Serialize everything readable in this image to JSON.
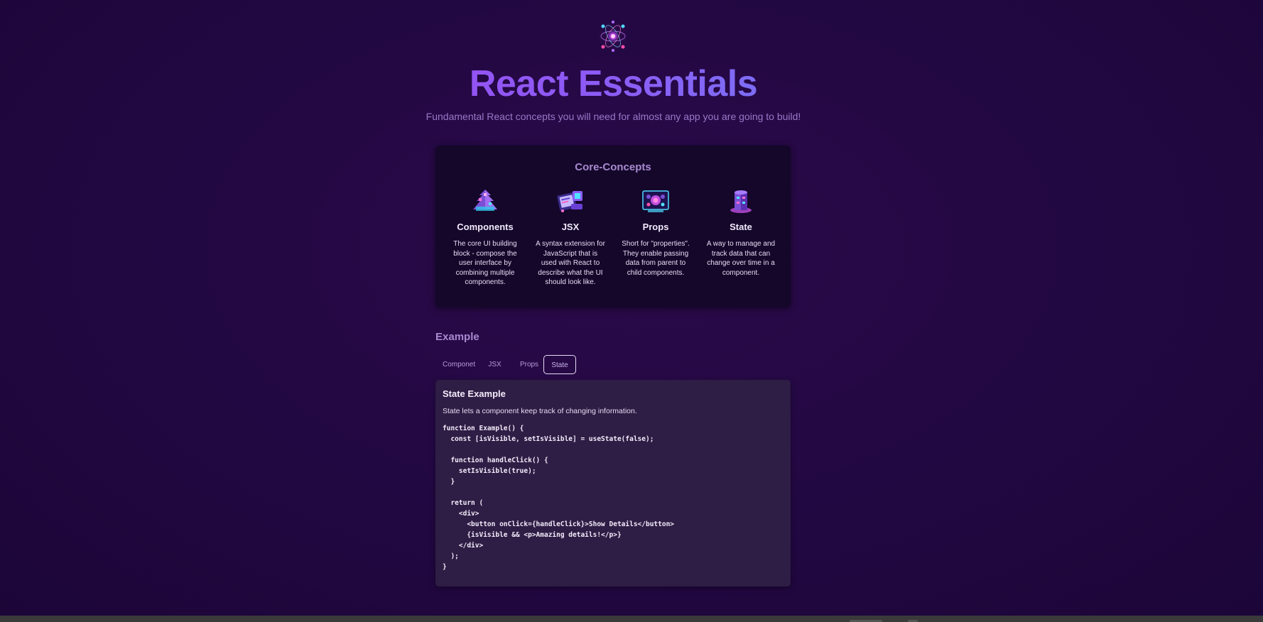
{
  "header": {
    "logo_icon": "atom-icon",
    "title": "React Essentials",
    "subtitle": "Fundamental React concepts you will need for almost any app you are going to build!"
  },
  "core_concepts": {
    "title": "Core-Concepts",
    "items": [
      {
        "icon": "components-icon",
        "name": "Components",
        "description": "The core UI building block - compose the user interface by combining multiple components."
      },
      {
        "icon": "jsx-icon",
        "name": "JSX",
        "description": "A syntax extension for JavaScript that is used with React to describe what the UI should look like."
      },
      {
        "icon": "props-icon",
        "name": "Props",
        "description": "Short for \"properties\". They enable passing data from parent to child components."
      },
      {
        "icon": "state-icon",
        "name": "State",
        "description": "A way to manage and track data that can change over time in a component."
      }
    ]
  },
  "example": {
    "heading": "Example",
    "tabs": [
      {
        "label": "Componet",
        "active": false
      },
      {
        "label": "JSX",
        "active": false
      },
      {
        "label": "Props",
        "active": false
      },
      {
        "label": "State",
        "active": true
      }
    ],
    "content": {
      "title": "State Example",
      "description": "State lets a component keep track of changing information.",
      "code": "function Example() {\n  const [isVisible, setIsVisible] = useState(false);\n\n  function handleClick() {\n    setIsVisible(true);\n  }\n\n  return (\n    <div>\n      <button onClick={handleClick}>Show Details</button>\n      {isVisible && <p>Amazing details!</p>}\n    </div>\n  );\n}"
    }
  },
  "colors": {
    "background": "#230843",
    "card_background": "#14072a",
    "example_background": "#2e1d44",
    "accent": "#a98ad0",
    "title_gradient_start": "#a93cf0",
    "title_gradient_end": "#4da3f7"
  }
}
